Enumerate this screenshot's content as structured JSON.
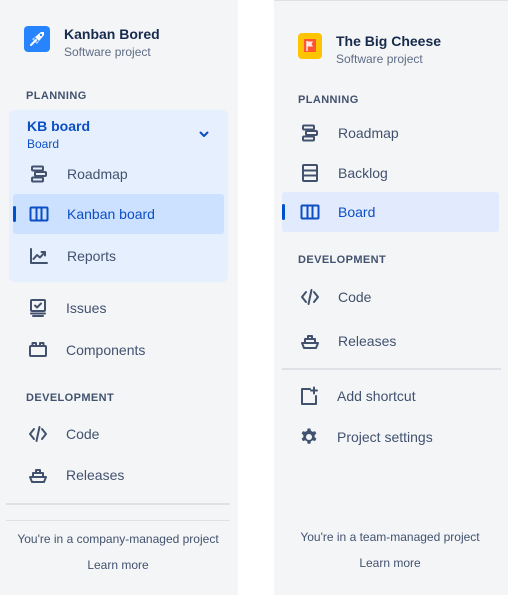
{
  "left": {
    "project": {
      "name": "Kanban Bored",
      "type": "Software project",
      "avatar_icon": "rocket-icon",
      "avatar_color": "#2684ff"
    },
    "planning_label": "PLANNING",
    "board_switcher": {
      "title": "KB board",
      "subtitle": "Board"
    },
    "planning_items": [
      {
        "label": "Roadmap",
        "icon": "roadmap-icon"
      },
      {
        "label": "Kanban board",
        "icon": "board-columns-icon",
        "selected": true
      },
      {
        "label": "Reports",
        "icon": "chart-line-icon"
      }
    ],
    "other_items": [
      {
        "label": "Issues",
        "icon": "issues-icon"
      },
      {
        "label": "Components",
        "icon": "components-icon"
      }
    ],
    "development_label": "DEVELOPMENT",
    "development_items": [
      {
        "label": "Code",
        "icon": "code-icon"
      },
      {
        "label": "Releases",
        "icon": "ship-icon"
      }
    ],
    "footer": {
      "text": "You're in a company-managed project",
      "link": "Learn more"
    }
  },
  "right": {
    "project": {
      "name": "The Big Cheese",
      "type": "Software project",
      "avatar_icon": "flag-icon",
      "avatar_color": "#ffab00"
    },
    "planning_label": "PLANNING",
    "planning_items": [
      {
        "label": "Roadmap",
        "icon": "roadmap-icon"
      },
      {
        "label": "Backlog",
        "icon": "backlog-icon"
      },
      {
        "label": "Board",
        "icon": "board-columns-icon",
        "selected": true
      }
    ],
    "development_label": "DEVELOPMENT",
    "development_items": [
      {
        "label": "Code",
        "icon": "code-icon"
      },
      {
        "label": "Releases",
        "icon": "ship-icon"
      }
    ],
    "extra_items": [
      {
        "label": "Add shortcut",
        "icon": "add-shortcut-icon"
      },
      {
        "label": "Project settings",
        "icon": "gear-icon"
      }
    ],
    "footer": {
      "text": "You're in a team-managed project",
      "link": "Learn more"
    }
  },
  "colors": {
    "accent": "#0c4fc4",
    "selected_bg": "#cce0ff",
    "group_bg": "#e6effd",
    "sidebar_bg": "#f4f5f7"
  }
}
